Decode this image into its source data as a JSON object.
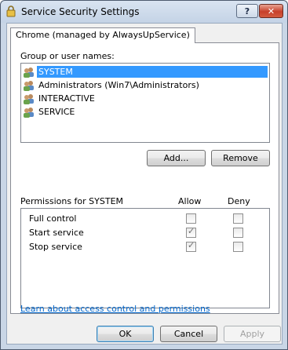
{
  "window": {
    "title": "Service Security Settings"
  },
  "titlebar": {
    "help_label": "?",
    "close_label": "✕"
  },
  "tab": {
    "label": "Chrome (managed by AlwaysUpService)"
  },
  "group": {
    "heading": "Group or user names:",
    "items": [
      {
        "label": "SYSTEM",
        "icon": "users-icon",
        "selected": true
      },
      {
        "label": "Administrators (Win7\\Administrators)",
        "icon": "users-icon",
        "selected": false
      },
      {
        "label": "INTERACTIVE",
        "icon": "users-icon",
        "selected": false
      },
      {
        "label": "SERVICE",
        "icon": "users-icon",
        "selected": false
      }
    ]
  },
  "buttons": {
    "add": "Add...",
    "remove": "Remove",
    "ok": "OK",
    "cancel": "Cancel",
    "apply": "Apply"
  },
  "permissions": {
    "heading": "Permissions for SYSTEM",
    "allow_header": "Allow",
    "deny_header": "Deny",
    "rows": [
      {
        "name": "Full control",
        "allow": false,
        "deny": false
      },
      {
        "name": "Start service",
        "allow": true,
        "deny": false
      },
      {
        "name": "Stop service",
        "allow": true,
        "deny": false
      }
    ]
  },
  "link": {
    "text": "Learn about access control and permissions"
  },
  "colors": {
    "selection": "#3399ff",
    "link": "#0066cc",
    "close_button": "#c7402a"
  }
}
